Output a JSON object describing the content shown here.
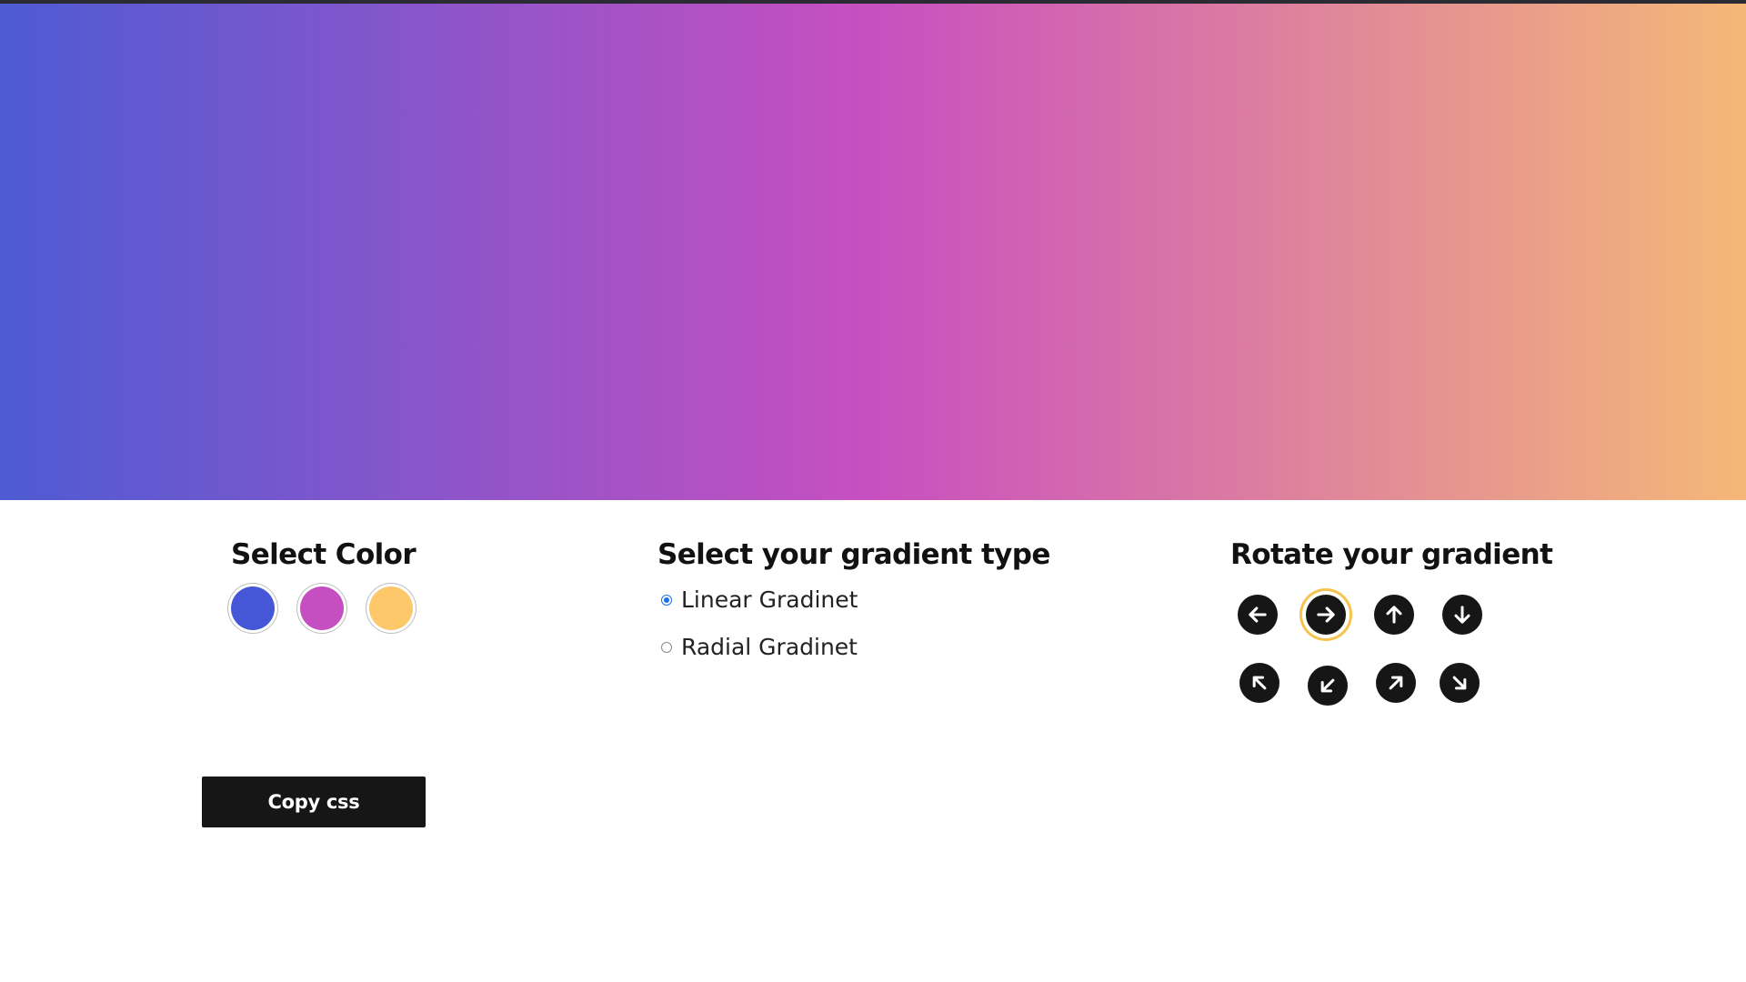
{
  "preview": {
    "gradient_type": "linear",
    "direction": "to right",
    "stops": [
      "#4e5bd3",
      "#c84fc0",
      "#f5b877"
    ]
  },
  "colors": {
    "title": "Select Color",
    "swatches": [
      {
        "name": "blue",
        "color": "#4557d6"
      },
      {
        "name": "magenta",
        "color": "#c54ec0"
      },
      {
        "name": "yellow",
        "color": "#fdc86a"
      }
    ]
  },
  "gradient_type": {
    "title": "Select your gradient type",
    "options": [
      {
        "label": "Linear Gradinet",
        "checked": true
      },
      {
        "label": "Radial Gradinet",
        "checked": false
      }
    ]
  },
  "rotate": {
    "title": "Rotate your gradient",
    "buttons": [
      {
        "icon": "arrow-left-icon",
        "active": false
      },
      {
        "icon": "arrow-right-icon",
        "active": true
      },
      {
        "icon": "arrow-up-icon",
        "active": false
      },
      {
        "icon": "arrow-down-icon",
        "active": false
      },
      {
        "icon": "arrow-up-left-icon",
        "active": false
      },
      {
        "icon": "arrow-down-left-icon",
        "active": false
      },
      {
        "icon": "arrow-up-right-icon",
        "active": false
      },
      {
        "icon": "arrow-down-right-icon",
        "active": false
      }
    ]
  },
  "actions": {
    "copy_label": "Copy css"
  },
  "theme": {
    "dark": "#161616",
    "radio_accent": "#1a73e8",
    "active_ring": "#f6c44e"
  }
}
